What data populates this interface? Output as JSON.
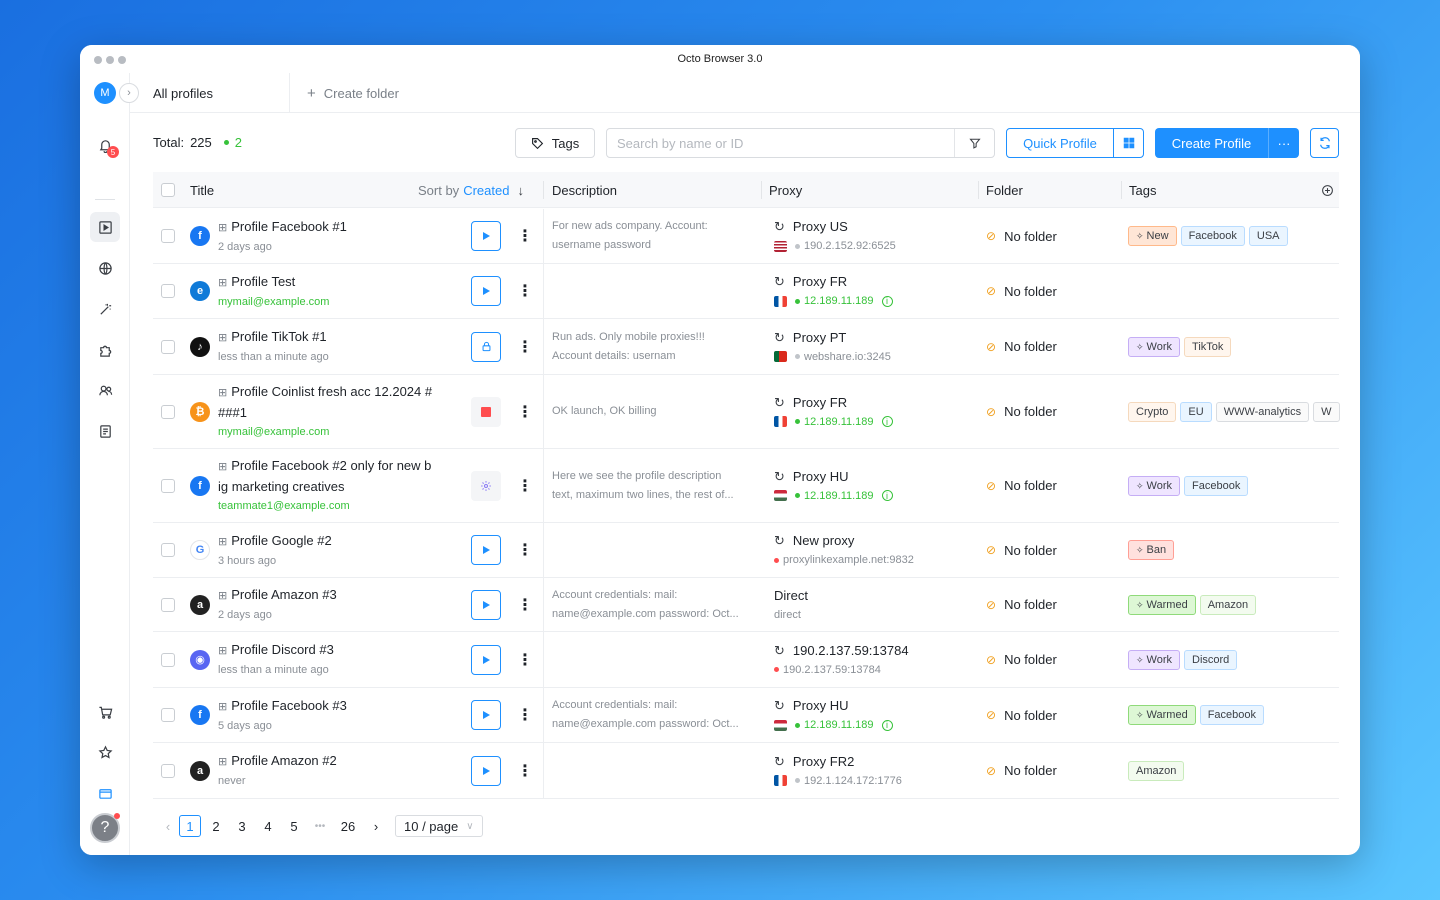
{
  "window": {
    "title": "Octo Browser 3.0"
  },
  "sidebar": {
    "avatar_letter": "M",
    "notif_count": "5",
    "help": "?"
  },
  "topbar": {
    "tab_all": "All profiles",
    "tab_create": "Create folder"
  },
  "toolbar": {
    "total_label": "Total:",
    "total_count": "225",
    "running_count": "2",
    "tags_label": "Tags",
    "search_placeholder": "Search by name or ID",
    "quick_profile": "Quick Profile",
    "create_profile": "Create Profile",
    "more": "···"
  },
  "table": {
    "headers": {
      "title": "Title",
      "sort_by": "Sort by",
      "sort_field": "Created",
      "description": "Description",
      "proxy": "Proxy",
      "folder": "Folder",
      "tags": "Tags"
    },
    "rows": [
      {
        "icon": "facebook-icon",
        "name": "Profile Facebook #1",
        "sub": "2 days ago",
        "sub_green": false,
        "action": "play",
        "desc1": "For new ads company. Account:",
        "desc2": "username password",
        "proxy": "Proxy US",
        "proxy_sub": "190.2.152.92:6525",
        "proxy_ok": false,
        "flag": "us",
        "folder": "No folder",
        "tags": [
          {
            "t": "New",
            "k": "new",
            "pin": true
          },
          {
            "t": "Facebook",
            "k": "blue"
          },
          {
            "t": "USA",
            "k": "blue"
          }
        ]
      },
      {
        "icon": "edge-icon",
        "name": "Profile Test",
        "sub": "mymail@example.com",
        "sub_green": true,
        "action": "play",
        "desc1": "",
        "desc2": "",
        "proxy": "Proxy FR",
        "proxy_sub": "12.189.11.189",
        "proxy_ok": true,
        "flag": "fr",
        "folder": "No folder",
        "tags": []
      },
      {
        "icon": "tiktok-icon",
        "name": "Profile TikTok #1",
        "sub": "less than a minute ago",
        "sub_green": false,
        "action": "lock",
        "desc1": "Run ads. Only mobile proxies!!!",
        "desc2": "Account details: usernam",
        "proxy": "Proxy PT",
        "proxy_sub": "webshare.io:3245",
        "proxy_ok": false,
        "flag": "pt",
        "folder": "No folder",
        "tags": [
          {
            "t": "Work",
            "k": "work",
            "pin": true
          },
          {
            "t": "TikTok",
            "k": "peach"
          }
        ]
      },
      {
        "icon": "bitcoin-icon",
        "name": "Profile Coinlist fresh acc 12.2024 #",
        "name2": "###1",
        "sub": "mymail@example.com",
        "sub_green": true,
        "action": "stop",
        "desc1": "OK launch, OK billing",
        "desc2": "",
        "proxy": "Proxy FR",
        "proxy_sub": "12.189.11.189",
        "proxy_ok": true,
        "flag": "fr",
        "folder": "No folder",
        "tags": [
          {
            "t": "Crypto",
            "k": "peach"
          },
          {
            "t": "EU",
            "k": "blue"
          },
          {
            "t": "WWW-analytics",
            "k": ""
          },
          {
            "t": "W",
            "k": ""
          }
        ]
      },
      {
        "icon": "facebook-icon",
        "name": "Profile Facebook #2 only for new b",
        "name2": "ig marketing creatives",
        "sub": "teammate1@example.com",
        "sub_green": true,
        "action": "gear",
        "desc1": "Here we see the profile description",
        "desc2": "text, maximum two lines, the rest of...",
        "proxy": "Proxy HU",
        "proxy_sub": "12.189.11.189",
        "proxy_ok": true,
        "flag": "hu",
        "folder": "No folder",
        "tags": [
          {
            "t": "Work",
            "k": "work",
            "pin": true
          },
          {
            "t": "Facebook",
            "k": "blue"
          }
        ]
      },
      {
        "icon": "google-icon",
        "name": "Profile Google #2",
        "sub": "3 hours ago",
        "sub_green": false,
        "action": "play",
        "desc1": "",
        "desc2": "",
        "proxy": "New proxy",
        "proxy_sub": "proxylinkexample.net:9832",
        "proxy_ok": false,
        "proxy_err": true,
        "flag": "",
        "folder": "No folder",
        "tags": [
          {
            "t": "Ban",
            "k": "ban",
            "pin": true
          }
        ]
      },
      {
        "icon": "amazon-icon",
        "name": "Profile Amazon #3",
        "sub": "2 days ago",
        "sub_green": false,
        "action": "play",
        "desc1": "Account credentials: mail:",
        "desc2": "name@example.com password: Oct...",
        "proxy": "Direct",
        "proxy_sub": "direct",
        "proxy_ok": false,
        "direct": true,
        "flag": "",
        "folder": "No folder",
        "tags": [
          {
            "t": "Warmed",
            "k": "warm",
            "pin": true
          },
          {
            "t": "Amazon",
            "k": "green"
          }
        ]
      },
      {
        "icon": "discord-icon",
        "name": "Profile Discord #3",
        "sub": "less than a minute ago",
        "sub_green": false,
        "action": "play",
        "desc1": "",
        "desc2": "",
        "proxy": "190.2.137.59:13784",
        "proxy_sub": "190.2.137.59:13784",
        "proxy_ok": false,
        "proxy_err": true,
        "flag": "",
        "folder": "No folder",
        "tags": [
          {
            "t": "Work",
            "k": "work",
            "pin": true
          },
          {
            "t": "Discord",
            "k": "blue"
          }
        ]
      },
      {
        "icon": "facebook-icon",
        "name": "Profile Facebook #3",
        "sub": "5 days ago",
        "sub_green": false,
        "action": "play",
        "desc1": "Account credentials: mail:",
        "desc2": "name@example.com password: Oct...",
        "proxy": "Proxy HU",
        "proxy_sub": "12.189.11.189",
        "proxy_ok": true,
        "flag": "hu",
        "folder": "No folder",
        "tags": [
          {
            "t": "Warmed",
            "k": "warm",
            "pin": true
          },
          {
            "t": "Facebook",
            "k": "blue"
          }
        ]
      },
      {
        "icon": "amazon-icon",
        "name": "Profile Amazon #2",
        "sub": "never",
        "sub_green": false,
        "action": "play",
        "desc1": "",
        "desc2": "",
        "proxy": "Proxy FR2",
        "proxy_sub": "192.1.124.172:1776",
        "proxy_ok": false,
        "flag": "fr",
        "folder": "No folder",
        "tags": [
          {
            "t": "Amazon",
            "k": "green"
          }
        ]
      }
    ]
  },
  "pagination": {
    "pages": [
      "1",
      "2",
      "3",
      "4",
      "5"
    ],
    "ellipsis": "•••",
    "last": "26",
    "per_page": "10 / page",
    "current": "1"
  },
  "colors": {
    "accent": "#1e90ff",
    "online": "#37c23a",
    "error": "#ff4d4f"
  }
}
